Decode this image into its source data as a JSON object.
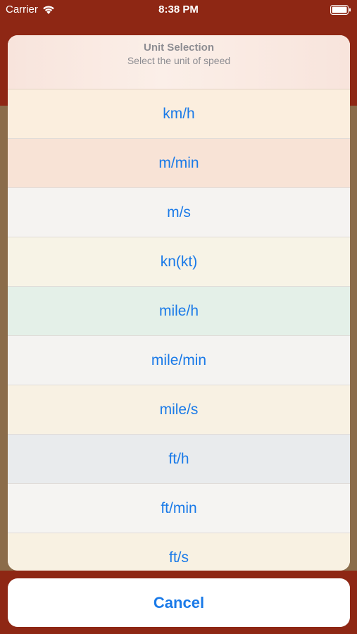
{
  "status_bar": {
    "carrier": "Carrier",
    "time": "8:38 PM"
  },
  "action_sheet": {
    "title": "Unit Selection",
    "message": "Select the unit of speed",
    "options": [
      {
        "label": "km/h",
        "tint": "#fbeede"
      },
      {
        "label": "m/min",
        "tint": "#f8e3d6"
      },
      {
        "label": "m/s",
        "tint": "#f5f3f1"
      },
      {
        "label": "kn(kt)",
        "tint": "#f7f3e6"
      },
      {
        "label": "mile/h",
        "tint": "#e4f0e8"
      },
      {
        "label": "mile/min",
        "tint": "#f4f3f1"
      },
      {
        "label": "mile/s",
        "tint": "#f8f1e3"
      },
      {
        "label": "ft/h",
        "tint": "#e9ebed"
      },
      {
        "label": "ft/min",
        "tint": "#f5f4f2"
      },
      {
        "label": "ft/s",
        "tint": "#f8f1e2"
      }
    ],
    "cancel_label": "Cancel"
  },
  "colors": {
    "accent": "#1a7ae8",
    "nav_background": "#8e2714",
    "content_background": "#8b6c4a"
  },
  "icons": [
    "wifi-icon",
    "battery-icon"
  ]
}
